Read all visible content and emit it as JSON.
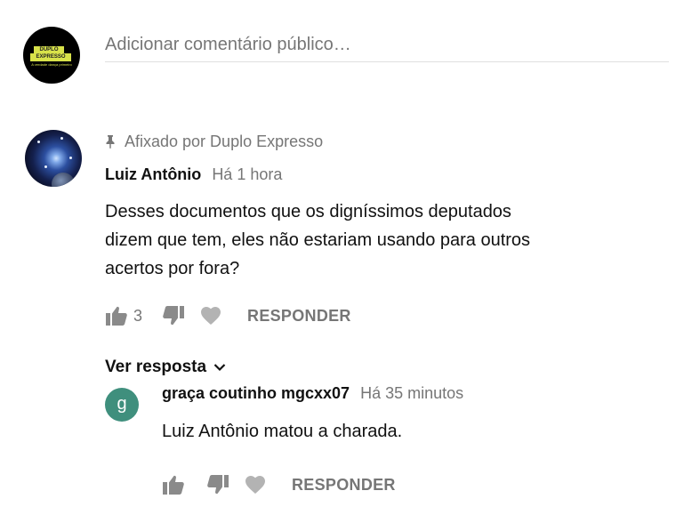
{
  "comment_box": {
    "placeholder": "Adicionar comentário público…",
    "avatar_logo_line1": "DUPLO",
    "avatar_logo_line2": "EXPRESSO",
    "avatar_logo_tagline": "A verdade dança primeiro"
  },
  "comment": {
    "pinned_label": "Afixado por Duplo Expresso",
    "author": "Luiz Antônio",
    "time": "Há 1 hora",
    "text_line1": "Desses documentos que os digníssimos deputados",
    "text_line2": "dizem que tem, eles não estariam usando para outros",
    "text_line3": "acertos por fora?",
    "likes": "3",
    "reply_label": "RESPONDER",
    "view_reply_label": "Ver resposta"
  },
  "reply": {
    "avatar_letter": "g",
    "author": "graça coutinho mgcxx07",
    "time": "Há 35 minutos",
    "text": "Luiz Antônio matou a charada.",
    "reply_label": "RESPONDER"
  },
  "colors": {
    "muted": "#767676",
    "reply_avatar_bg": "#3f8f7d",
    "logo_accent": "#d8e24a"
  }
}
